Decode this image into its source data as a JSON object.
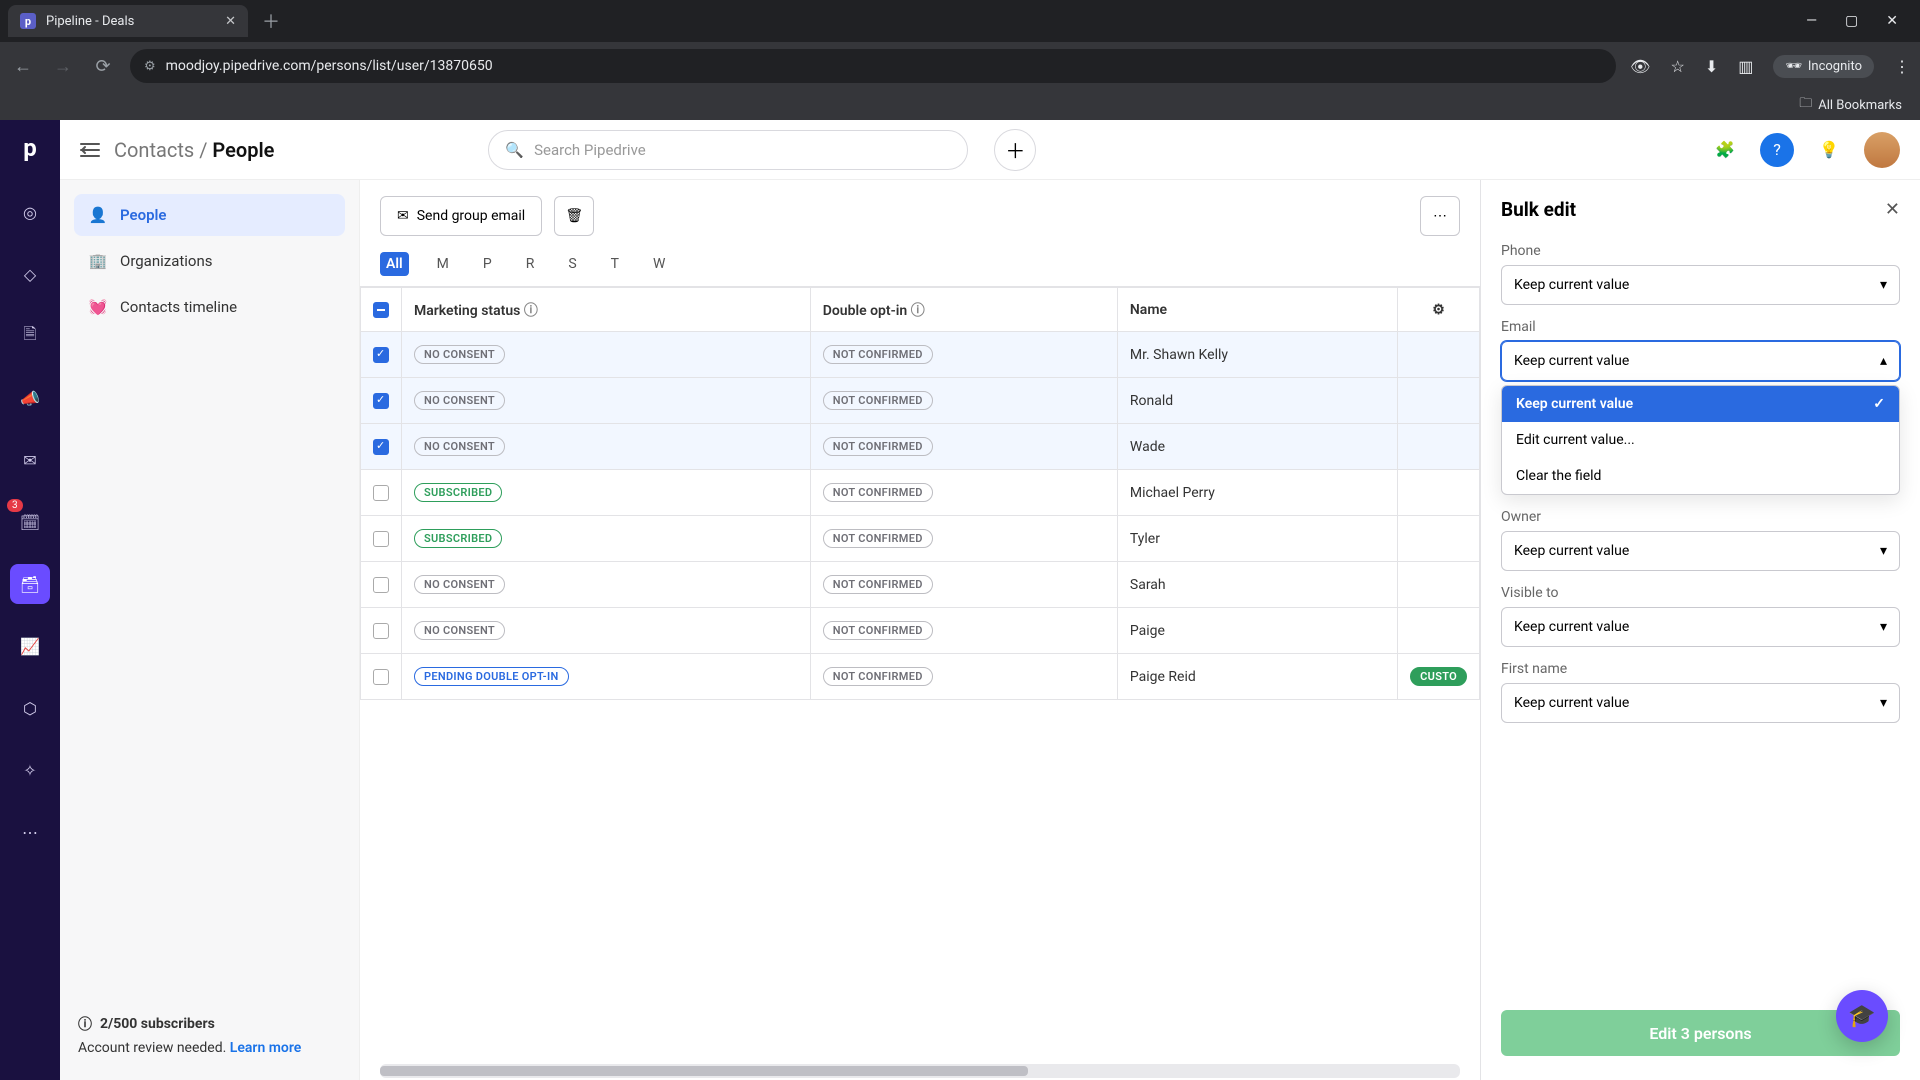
{
  "browser": {
    "tab_title": "Pipeline - Deals",
    "url": "moodjoy.pipedrive.com/persons/list/user/13870650",
    "incognito_label": "Incognito",
    "bookmarks_label": "All Bookmarks"
  },
  "header": {
    "breadcrumb_parent": "Contacts",
    "breadcrumb_current": "People",
    "search_placeholder": "Search Pipedrive"
  },
  "rail_badge": "3",
  "sidebar": {
    "items": [
      {
        "label": "People"
      },
      {
        "label": "Organizations"
      },
      {
        "label": "Contacts timeline"
      }
    ],
    "alert": {
      "title": "2/500 subscribers",
      "body": "Account review needed.",
      "link": "Learn more"
    }
  },
  "toolbar": {
    "group_email": "Send group email"
  },
  "filter_letters": [
    "All",
    "M",
    "P",
    "R",
    "S",
    "T",
    "W"
  ],
  "table": {
    "columns": [
      "Marketing status",
      "Double opt-in",
      "Name"
    ],
    "rows": [
      {
        "selected": true,
        "status": "NO CONSENT",
        "status_style": "grey",
        "optin": "NOT CONFIRMED",
        "name": "Mr. Shawn Kelly"
      },
      {
        "selected": true,
        "status": "NO CONSENT",
        "status_style": "grey",
        "optin": "NOT CONFIRMED",
        "name": "Ronald"
      },
      {
        "selected": true,
        "status": "NO CONSENT",
        "status_style": "grey",
        "optin": "NOT CONFIRMED",
        "name": "Wade"
      },
      {
        "selected": false,
        "status": "SUBSCRIBED",
        "status_style": "green",
        "optin": "NOT CONFIRMED",
        "name": "Michael Perry"
      },
      {
        "selected": false,
        "status": "SUBSCRIBED",
        "status_style": "green",
        "optin": "NOT CONFIRMED",
        "name": "Tyler"
      },
      {
        "selected": false,
        "status": "NO CONSENT",
        "status_style": "grey",
        "optin": "NOT CONFIRMED",
        "name": "Sarah"
      },
      {
        "selected": false,
        "status": "NO CONSENT",
        "status_style": "grey",
        "optin": "NOT CONFIRMED",
        "name": "Paige"
      },
      {
        "selected": false,
        "status": "PENDING DOUBLE OPT-IN",
        "status_style": "blue",
        "optin": "NOT CONFIRMED",
        "name": "Paige Reid",
        "tag": "CUSTO"
      }
    ]
  },
  "bulk": {
    "title": "Bulk edit",
    "keep_current": "Keep current value",
    "fields": {
      "phone": "Phone",
      "email": "Email",
      "owner": "Owner",
      "visible_to": "Visible to",
      "first_name": "First name"
    },
    "dropdown_options": [
      "Keep current value",
      "Edit current value...",
      "Clear the field"
    ],
    "submit": "Edit 3 persons"
  }
}
